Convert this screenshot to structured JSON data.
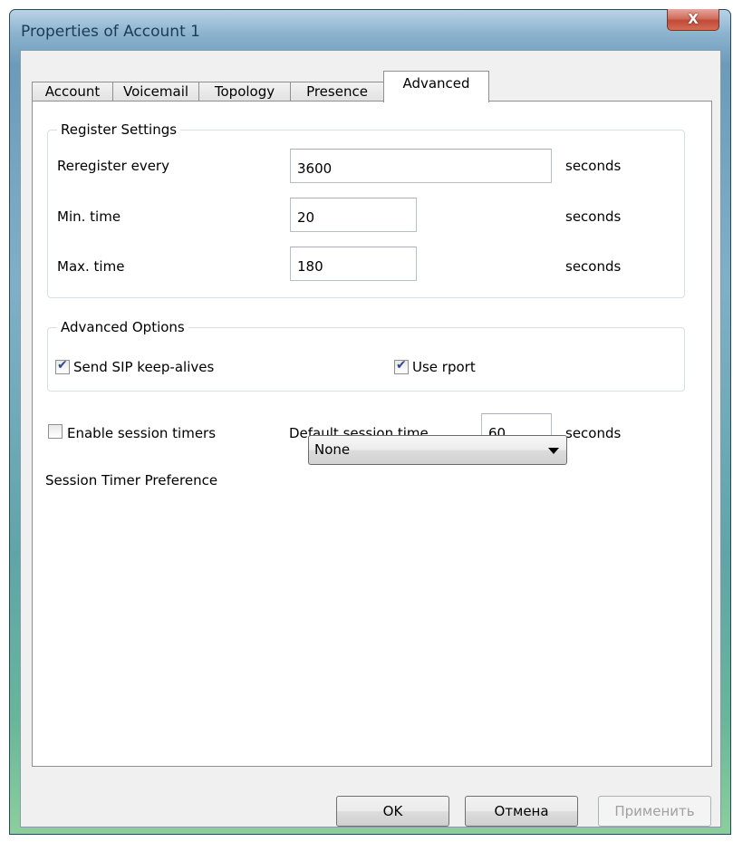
{
  "window": {
    "title": "Properties of Account 1",
    "close_glyph": "X"
  },
  "tabs": [
    {
      "label": "Account"
    },
    {
      "label": "Voicemail"
    },
    {
      "label": "Topology"
    },
    {
      "label": "Presence"
    },
    {
      "label": "Advanced",
      "active": true
    }
  ],
  "register_settings": {
    "title": "Register Settings",
    "reregister_label": "Reregister every",
    "reregister_value": "3600",
    "reregister_unit": "seconds",
    "min_label": "Min. time",
    "min_value": "20",
    "min_unit": "seconds",
    "max_label": "Max. time",
    "max_value": "180",
    "max_unit": "seconds"
  },
  "advanced_options": {
    "title": "Advanced Options",
    "keepalive_label": "Send SIP keep-alives",
    "keepalive_checked": true,
    "rport_label": "Use rport",
    "rport_checked": true
  },
  "session": {
    "enable_label": "Enable session timers",
    "enable_checked": false,
    "default_time_label": "Default session time",
    "default_time_value": "60",
    "default_time_unit": "seconds",
    "preference_label": "Session Timer Preference",
    "preference_value": "None"
  },
  "buttons": {
    "ok": "OK",
    "cancel": "Отмена",
    "apply": "Применить"
  }
}
